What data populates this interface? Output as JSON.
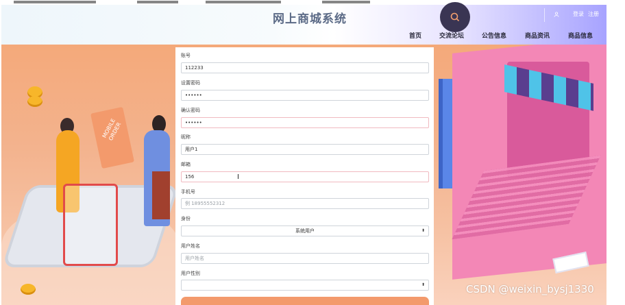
{
  "header": {
    "site_title": "网上商城系统",
    "auth_login": "登录",
    "auth_register": "注册",
    "nav": [
      "首页",
      "交流论坛",
      "公告信息",
      "商品资讯",
      "商品信息"
    ]
  },
  "illustration": {
    "sign_text": "MOBILE ORDER"
  },
  "form": {
    "fields": [
      {
        "label": "账号",
        "value": "112233",
        "placeholder": ""
      },
      {
        "label": "设置密码",
        "value": "••••••",
        "placeholder": ""
      },
      {
        "label": "确认密码",
        "value": "••••••",
        "placeholder": ""
      },
      {
        "label": "昵称",
        "value": "用户1",
        "placeholder": ""
      },
      {
        "label": "邮箱",
        "value": "156",
        "placeholder": ""
      },
      {
        "label": "手机号",
        "value": "",
        "placeholder": "例  18955552312"
      },
      {
        "label": "身份",
        "value": "系统用户",
        "placeholder": ""
      },
      {
        "label": "用户姓名",
        "value": "",
        "placeholder": "用户姓名"
      },
      {
        "label": "用户性别",
        "value": "",
        "placeholder": ""
      }
    ]
  },
  "watermark": "CSDN @weixin_bysj1330",
  "colors": {
    "header_accent": "#a7a3ff",
    "search_circle": "#3a3553",
    "submit_button": "#f39a6c",
    "background_peach": "#f4a97a",
    "laptop_pink": "#f387b6"
  },
  "icons": {
    "search": "search-icon",
    "user": "user-icon",
    "select_arrow": "updown-arrow-icon",
    "text_cursor": "text-cursor-icon"
  }
}
